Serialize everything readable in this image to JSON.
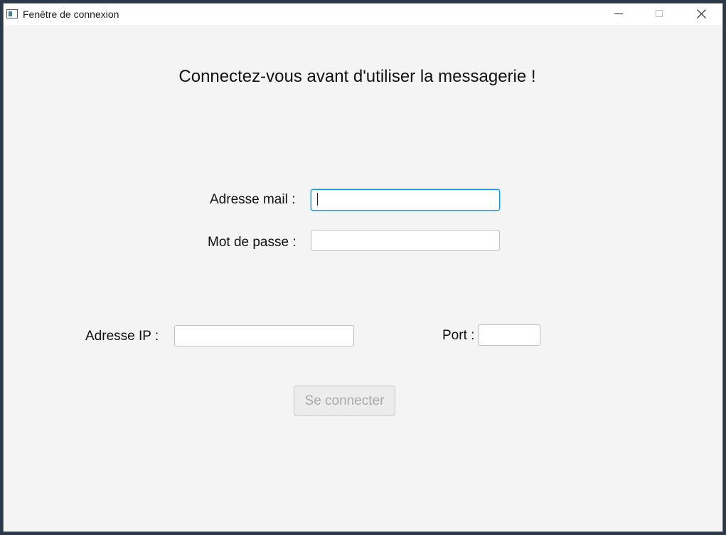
{
  "window": {
    "title": "Fenêtre de connexion",
    "icons": {
      "app": "app-window-icon",
      "minimize": "minimize-icon",
      "maximize": "maximize-icon",
      "close": "close-icon"
    }
  },
  "form": {
    "heading": "Connectez-vous avant d'utiliser la messagerie !",
    "email_label": "Adresse mail :",
    "email_value": "",
    "password_label": "Mot de passe :",
    "password_value": "",
    "ip_label": "Adresse IP :",
    "ip_value": "",
    "port_label": "Port :",
    "port_value": "",
    "connect_label": "Se connecter"
  },
  "colors": {
    "focus_border": "#0f96d8",
    "background": "#f4f4f4",
    "disabled_text": "#a8a8a8"
  }
}
